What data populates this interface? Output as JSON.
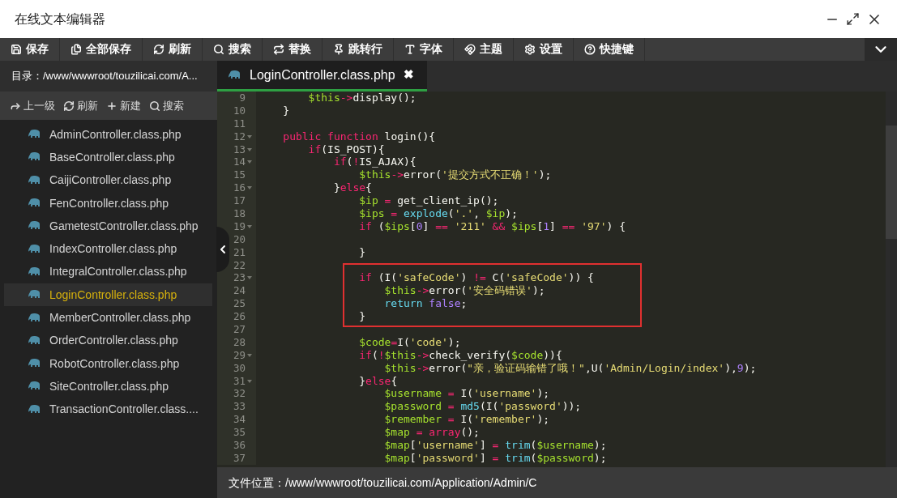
{
  "window": {
    "title": "在线文本编辑器"
  },
  "toolbar": [
    {
      "label": "保存"
    },
    {
      "label": "全部保存"
    },
    {
      "label": "刷新"
    },
    {
      "label": "搜索"
    },
    {
      "label": "替换"
    },
    {
      "label": "跳转行"
    },
    {
      "label": "字体"
    },
    {
      "label": "主题"
    },
    {
      "label": "设置"
    },
    {
      "label": "快捷键"
    }
  ],
  "sidebar": {
    "path": "目录：/www/wwwroot/touzilicai.com/A...",
    "actions": [
      {
        "label": "上一级"
      },
      {
        "label": "刷新"
      },
      {
        "label": "新建"
      },
      {
        "label": "搜索"
      }
    ],
    "files": [
      {
        "name": "AdminController.class.php",
        "selected": false
      },
      {
        "name": "BaseController.class.php",
        "selected": false
      },
      {
        "name": "CaijiController.class.php",
        "selected": false
      },
      {
        "name": "FenController.class.php",
        "selected": false
      },
      {
        "name": "GametestController.class.php",
        "selected": false
      },
      {
        "name": "IndexController.class.php",
        "selected": false
      },
      {
        "name": "IntegralController.class.php",
        "selected": false
      },
      {
        "name": "LoginController.class.php",
        "selected": true
      },
      {
        "name": "MemberController.class.php",
        "selected": false
      },
      {
        "name": "OrderController.class.php",
        "selected": false
      },
      {
        "name": "RobotController.class.php",
        "selected": false
      },
      {
        "name": "SiteController.class.php",
        "selected": false
      },
      {
        "name": "TransactionController.class....",
        "selected": false
      }
    ]
  },
  "editor": {
    "tabs": [
      {
        "label": "LoginController.class.php",
        "close": "✖",
        "selected": true
      }
    ],
    "blocks": [
      {
        "lines": [
          {
            "number": "9",
            "fold": false,
            "tokens": [
              {
                "kind": "var",
                "text": "        $this"
              },
              {
                "kind": "op",
                "text": "->"
              },
              {
                "kind": "plain",
                "text": "display();"
              }
            ]
          },
          {
            "number": "10",
            "fold": false,
            "tokens": [
              {
                "kind": "plain",
                "text": "    }"
              }
            ]
          },
          {
            "number": "11",
            "fold": false
          },
          {
            "number": "12",
            "fold": true,
            "tokens": [
              {
                "kind": "keyword",
                "text": "    public"
              },
              {
                "kind": "keyword",
                "text": " function"
              },
              {
                "kind": "plain",
                "text": " login(){"
              }
            ]
          },
          {
            "number": "13",
            "fold": true,
            "tokens": [
              {
                "kind": "keyword",
                "text": "        if"
              },
              {
                "kind": "plain",
                "text": "(IS_POST){"
              }
            ]
          },
          {
            "number": "14",
            "fold": true,
            "tokens": [
              {
                "kind": "keyword",
                "text": "            if"
              },
              {
                "kind": "plain",
                "text": "("
              },
              {
                "kind": "op",
                "text": "!"
              },
              {
                "kind": "plain",
                "text": "IS_AJAX){"
              }
            ]
          },
          {
            "number": "15",
            "fold": false,
            "tokens": [
              {
                "kind": "var",
                "text": "                $this"
              },
              {
                "kind": "op",
                "text": "->"
              },
              {
                "kind": "plain",
                "text": "error("
              },
              {
                "kind": "string",
                "text": "'提交方式不正确！'"
              },
              {
                "kind": "plain",
                "text": ");"
              }
            ]
          },
          {
            "number": "16",
            "fold": true,
            "tokens": [
              {
                "kind": "plain",
                "text": "            }"
              },
              {
                "kind": "keyword",
                "text": "else"
              },
              {
                "kind": "plain",
                "text": "{"
              }
            ]
          },
          {
            "number": "17",
            "fold": false,
            "tokens": [
              {
                "kind": "var",
                "text": "                $ip"
              },
              {
                "kind": "op",
                "text": " ="
              },
              {
                "kind": "plain",
                "text": " get_client_ip();"
              }
            ]
          },
          {
            "number": "18",
            "fold": false,
            "tokens": [
              {
                "kind": "var",
                "text": "                $ips"
              },
              {
                "kind": "op",
                "text": " ="
              },
              {
                "kind": "function",
                "text": " explode"
              },
              {
                "kind": "plain",
                "text": "("
              },
              {
                "kind": "string",
                "text": "'.'"
              },
              {
                "kind": "plain",
                "text": ","
              },
              {
                "kind": "var",
                "text": " $ip"
              },
              {
                "kind": "plain",
                "text": ");"
              }
            ]
          },
          {
            "number": "19",
            "fold": true,
            "tokens": [
              {
                "kind": "keyword",
                "text": "                if"
              },
              {
                "kind": "plain",
                "text": " ("
              },
              {
                "kind": "var",
                "text": "$ips"
              },
              {
                "kind": "plain",
                "text": "["
              },
              {
                "kind": "number",
                "text": "0"
              },
              {
                "kind": "plain",
                "text": "]"
              },
              {
                "kind": "op",
                "text": " =="
              },
              {
                "kind": "string",
                "text": " '211'"
              },
              {
                "kind": "op",
                "text": " &&"
              },
              {
                "kind": "var",
                "text": " $ips"
              },
              {
                "kind": "plain",
                "text": "["
              },
              {
                "kind": "number",
                "text": "1"
              },
              {
                "kind": "plain",
                "text": "]"
              },
              {
                "kind": "op",
                "text": " =="
              },
              {
                "kind": "string",
                "text": " '97'"
              },
              {
                "kind": "plain",
                "text": ") {"
              }
            ]
          },
          {
            "number": "20",
            "fold": false
          },
          {
            "number": "21",
            "fold": false,
            "tokens": [
              {
                "kind": "plain",
                "text": "                }"
              }
            ]
          },
          {
            "number": "22",
            "fold": false
          }
        ]
      },
      {
        "framed": true,
        "lines": [
          {
            "number": "23",
            "fold": true,
            "tokens": [
              {
                "kind": "keyword",
                "text": "                if"
              },
              {
                "kind": "plain",
                "text": " (I("
              },
              {
                "kind": "string",
                "text": "'safeCode'"
              },
              {
                "kind": "plain",
                "text": ")"
              },
              {
                "kind": "op",
                "text": " !="
              },
              {
                "kind": "plain",
                "text": " C("
              },
              {
                "kind": "string",
                "text": "'safeCode'"
              },
              {
                "kind": "plain",
                "text": ")) {"
              }
            ]
          },
          {
            "number": "24",
            "fold": false,
            "tokens": [
              {
                "kind": "var",
                "text": "                    $this"
              },
              {
                "kind": "op",
                "text": "->"
              },
              {
                "kind": "plain",
                "text": "error("
              },
              {
                "kind": "string",
                "text": "'安全码错误'"
              },
              {
                "kind": "plain",
                "text": ");"
              }
            ]
          },
          {
            "number": "25",
            "fold": false,
            "tokens": [
              {
                "kind": "function",
                "text": "                    return"
              },
              {
                "kind": "number",
                "text": " false"
              },
              {
                "kind": "plain",
                "text": ";"
              }
            ]
          },
          {
            "number": "26",
            "fold": false,
            "tokens": [
              {
                "kind": "plain",
                "text": "                }"
              }
            ]
          }
        ]
      },
      {
        "lines": [
          {
            "number": "27",
            "fold": false
          },
          {
            "number": "28",
            "fold": false,
            "tokens": [
              {
                "kind": "var",
                "text": "                $code"
              },
              {
                "kind": "op",
                "text": "="
              },
              {
                "kind": "plain",
                "text": "I("
              },
              {
                "kind": "string",
                "text": "'code'"
              },
              {
                "kind": "plain",
                "text": ");"
              }
            ]
          },
          {
            "number": "29",
            "fold": true,
            "tokens": [
              {
                "kind": "keyword",
                "text": "                if"
              },
              {
                "kind": "plain",
                "text": "("
              },
              {
                "kind": "op",
                "text": "!"
              },
              {
                "kind": "var",
                "text": "$this"
              },
              {
                "kind": "op",
                "text": "->"
              },
              {
                "kind": "plain",
                "text": "check_verify("
              },
              {
                "kind": "var",
                "text": "$code"
              },
              {
                "kind": "plain",
                "text": ")){"
              }
            ]
          },
          {
            "number": "30",
            "fold": false,
            "tokens": [
              {
                "kind": "var",
                "text": "                    $this"
              },
              {
                "kind": "op",
                "text": "->"
              },
              {
                "kind": "plain",
                "text": "error("
              },
              {
                "kind": "string",
                "text": "\"亲，验证码输错了哦！\""
              },
              {
                "kind": "plain",
                "text": ",U("
              },
              {
                "kind": "string",
                "text": "'Admin/Login/index'"
              },
              {
                "kind": "plain",
                "text": "),"
              },
              {
                "kind": "number",
                "text": "9"
              },
              {
                "kind": "plain",
                "text": ");"
              }
            ]
          },
          {
            "number": "31",
            "fold": true,
            "tokens": [
              {
                "kind": "plain",
                "text": "                }"
              },
              {
                "kind": "keyword",
                "text": "else"
              },
              {
                "kind": "plain",
                "text": "{"
              }
            ]
          },
          {
            "number": "32",
            "fold": false,
            "tokens": [
              {
                "kind": "var",
                "text": "                    $username"
              },
              {
                "kind": "op",
                "text": " ="
              },
              {
                "kind": "plain",
                "text": " I("
              },
              {
                "kind": "string",
                "text": "'username'"
              },
              {
                "kind": "plain",
                "text": ");"
              }
            ]
          },
          {
            "number": "33",
            "fold": false,
            "tokens": [
              {
                "kind": "var",
                "text": "                    $password"
              },
              {
                "kind": "op",
                "text": " ="
              },
              {
                "kind": "function",
                "text": " md5"
              },
              {
                "kind": "plain",
                "text": "(I("
              },
              {
                "kind": "string",
                "text": "'password'"
              },
              {
                "kind": "plain",
                "text": "));"
              }
            ]
          },
          {
            "number": "34",
            "fold": false,
            "tokens": [
              {
                "kind": "var",
                "text": "                    $remember"
              },
              {
                "kind": "op",
                "text": " ="
              },
              {
                "kind": "plain",
                "text": " I("
              },
              {
                "kind": "string",
                "text": "'remember'"
              },
              {
                "kind": "plain",
                "text": ");"
              }
            ]
          },
          {
            "number": "35",
            "fold": false,
            "tokens": [
              {
                "kind": "var",
                "text": "                    $map"
              },
              {
                "kind": "op",
                "text": " ="
              },
              {
                "kind": "keyword",
                "text": " array"
              },
              {
                "kind": "plain",
                "text": "();"
              }
            ]
          },
          {
            "number": "36",
            "fold": false,
            "tokens": [
              {
                "kind": "var",
                "text": "                    $map"
              },
              {
                "kind": "plain",
                "text": "["
              },
              {
                "kind": "string",
                "text": "'username'"
              },
              {
                "kind": "plain",
                "text": "]"
              },
              {
                "kind": "op",
                "text": " ="
              },
              {
                "kind": "function",
                "text": " trim"
              },
              {
                "kind": "plain",
                "text": "("
              },
              {
                "kind": "var",
                "text": "$username"
              },
              {
                "kind": "plain",
                "text": ");"
              }
            ]
          },
          {
            "number": "37",
            "fold": false,
            "tokens": [
              {
                "kind": "var",
                "text": "                    $map"
              },
              {
                "kind": "plain",
                "text": "["
              },
              {
                "kind": "string",
                "text": "'password'"
              },
              {
                "kind": "plain",
                "text": "]"
              },
              {
                "kind": "op",
                "text": " ="
              },
              {
                "kind": "function",
                "text": " trim"
              },
              {
                "kind": "plain",
                "text": "("
              },
              {
                "kind": "var",
                "text": "$password"
              },
              {
                "kind": "plain",
                "text": ");"
              }
            ]
          }
        ]
      }
    ]
  },
  "status_bar": {
    "path": "文件位置：/www/wwwroot/touzilicai.com/Application/Admin/C"
  }
}
